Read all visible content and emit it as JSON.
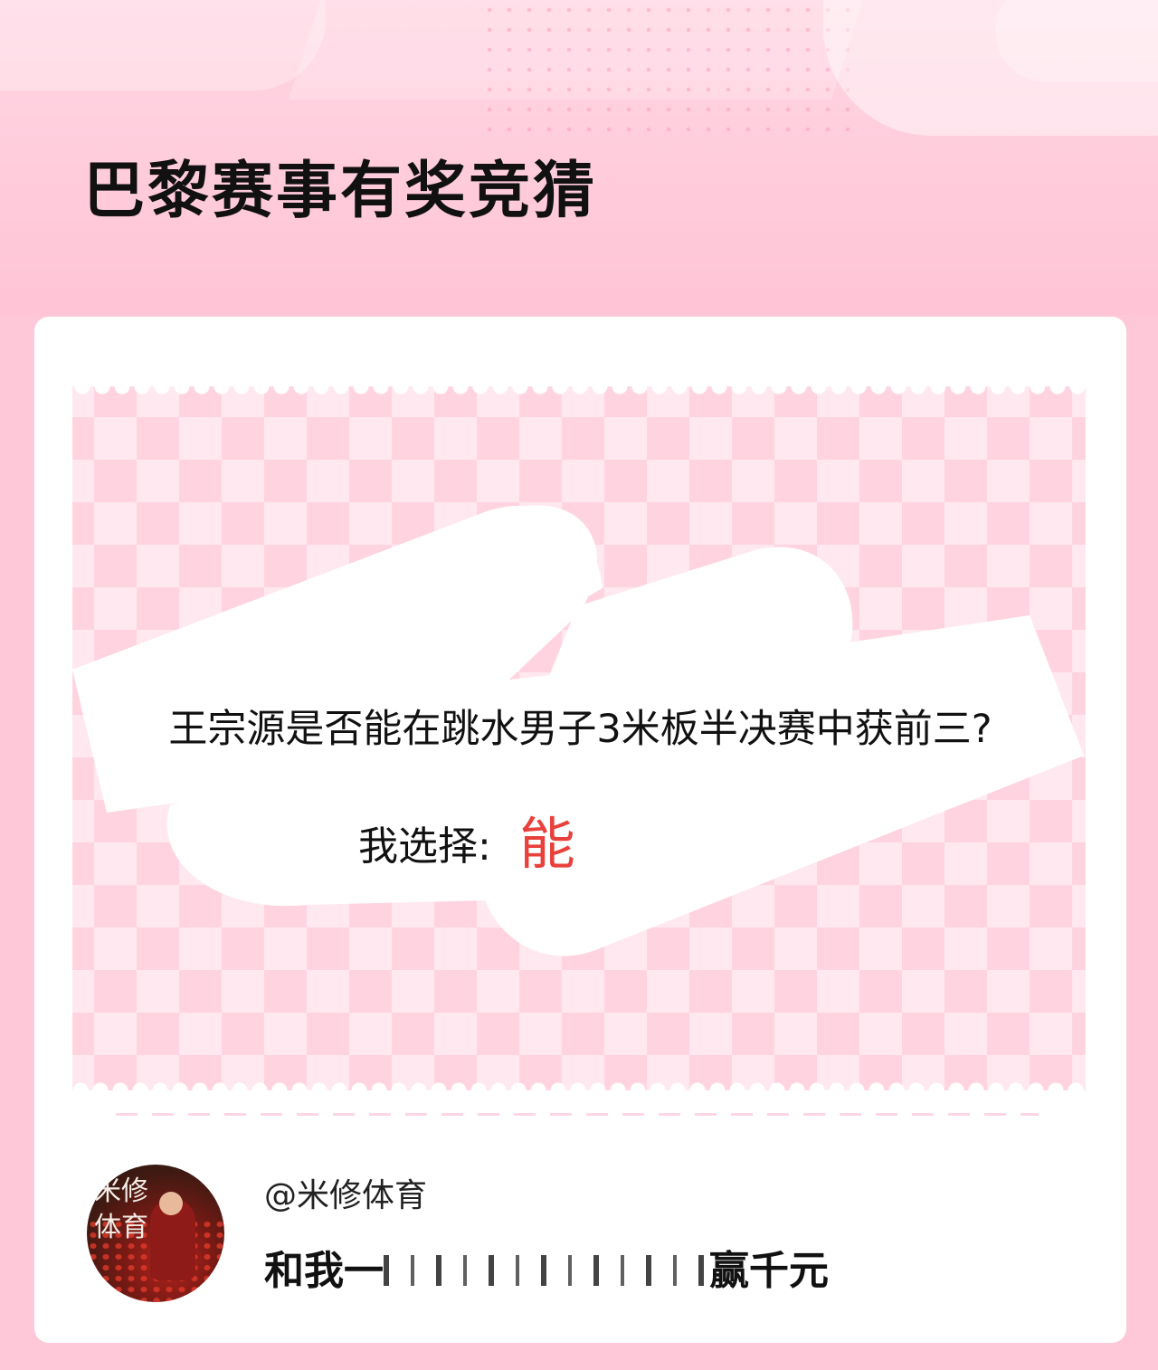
{
  "header": {
    "title": "巴黎赛事有奖竞猜"
  },
  "card": {
    "question": "王宗源是否能在跳水男子3米板半决赛中获前三?",
    "choice_label": "我选择:",
    "choice_value": "能",
    "choice_value_color": "#e8413b"
  },
  "footer": {
    "avatar_text": "米修 体育",
    "username": "@米修体育",
    "promo_prefix": "和我一",
    "promo_suffix": "赢千元"
  },
  "colors": {
    "background_pink": "#ffc8d9",
    "card_white": "#ffffff",
    "ticket_pink": "#ffe8ef"
  }
}
